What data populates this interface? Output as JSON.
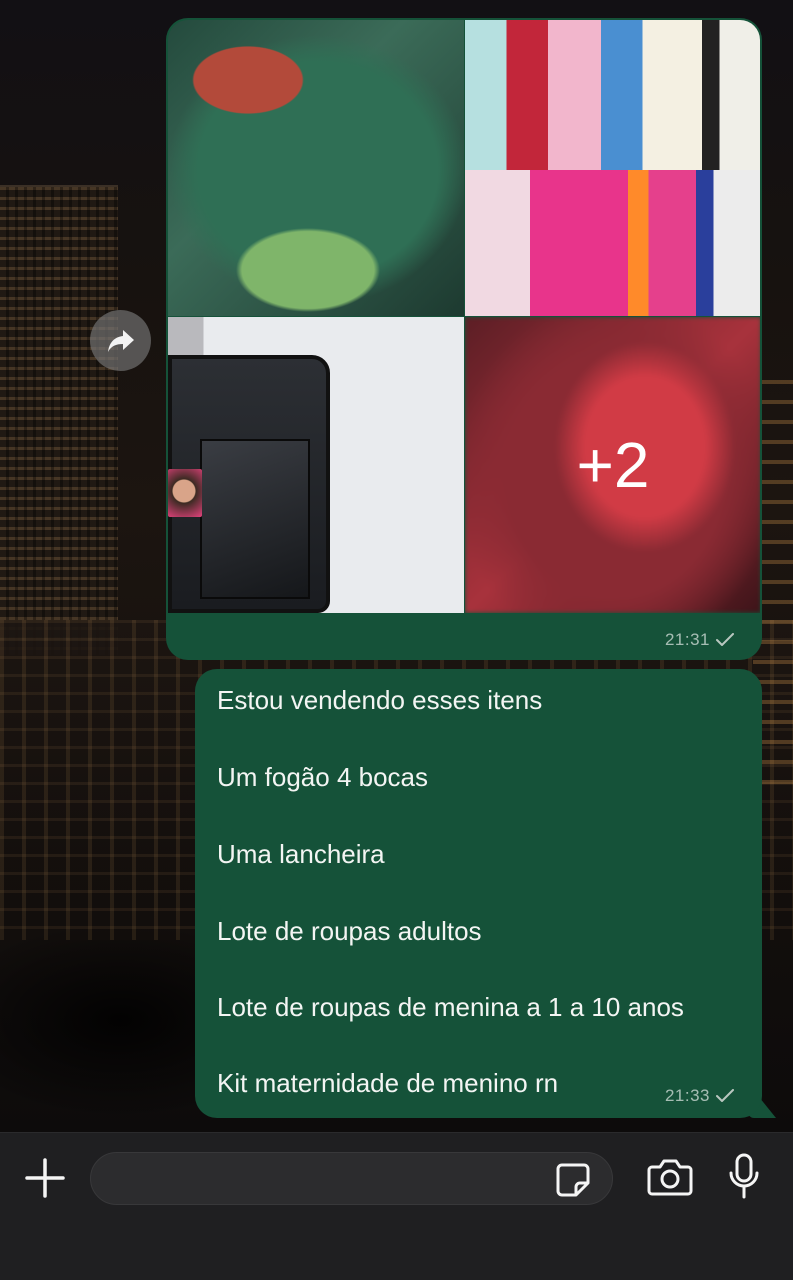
{
  "chat": {
    "media_message": {
      "extra_photos_label": "+2",
      "time": "21:31",
      "status_icon": "check-icon"
    },
    "text_message": {
      "lines": [
        "Estou vendendo esses itens",
        "Um fogão 4 bocas",
        "Uma lancheira",
        "Lote de roupas adultos",
        "Lote de roupas de menina a 1 a 10 anos",
        "Kit maternidade de menino rn"
      ],
      "time": "21:33",
      "status_icon": "check-icon"
    }
  },
  "colors": {
    "outgoing_bubble": "#155239",
    "input_bar": "#1f1f21",
    "timestamp": "#9fb3a9"
  },
  "input_bar": {
    "message_value": "",
    "icons": [
      "plus-icon",
      "sticker-icon",
      "camera-icon",
      "microphone-icon"
    ]
  },
  "actions": {
    "forward_icon": "forward-arrow-icon"
  }
}
